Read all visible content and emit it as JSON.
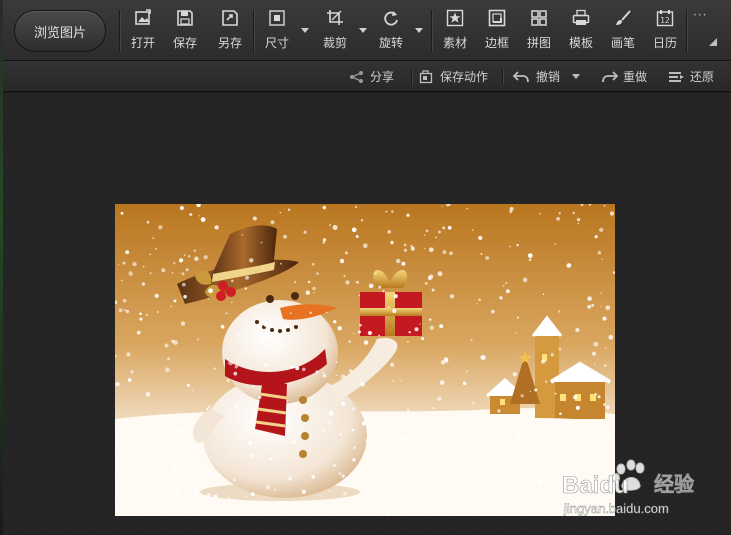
{
  "toolbar": {
    "browse_label": "浏览图片",
    "tools": [
      {
        "label": "打开",
        "icon": "open-image-icon"
      },
      {
        "label": "保存",
        "icon": "save-disk-icon"
      },
      {
        "label": "另存",
        "icon": "save-as-icon"
      },
      {
        "label": "尺寸",
        "icon": "resize-icon"
      },
      {
        "label": "裁剪",
        "icon": "crop-icon"
      },
      {
        "label": "旋转",
        "icon": "rotate-icon"
      },
      {
        "label": "素材",
        "icon": "star-material-icon"
      },
      {
        "label": "边框",
        "icon": "frame-icon"
      },
      {
        "label": "拼图",
        "icon": "collage-grid-icon"
      },
      {
        "label": "模板",
        "icon": "template-printer-icon"
      },
      {
        "label": "画笔",
        "icon": "brush-icon"
      },
      {
        "label": "日历",
        "icon": "calendar-icon"
      }
    ],
    "calendar_day": "12",
    "more_label": "···"
  },
  "subbar": {
    "share_label": "分享",
    "save_action_label": "保存动作",
    "undo_label": "撤销",
    "redo_label": "重做",
    "restore_label": "还原"
  },
  "watermark": {
    "brand": "Baidu",
    "brand_suffix": "经验",
    "url": "jingyan.baidu.com"
  },
  "colors": {
    "toolbar_bg": "#333333",
    "canvas_bg": "#232323",
    "text": "#d8d8d8",
    "photo_sky": "#c98a2e",
    "snow": "#ffffff",
    "scarf_red": "#b3151b"
  }
}
